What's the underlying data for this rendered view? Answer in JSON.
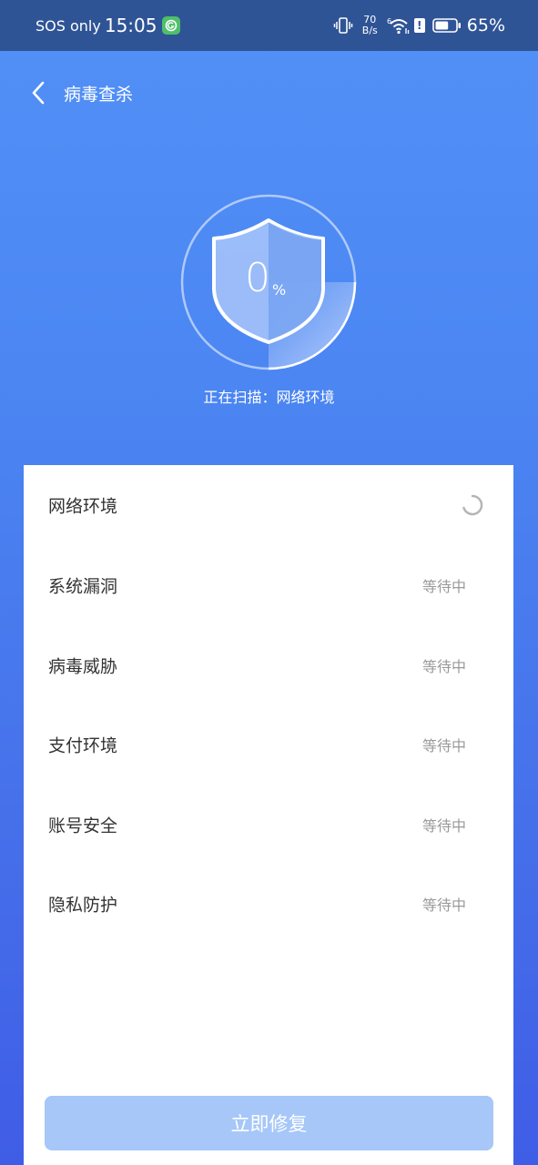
{
  "status_bar": {
    "carrier": "SOS only",
    "time": "15:05",
    "net_speed_value": "70",
    "net_speed_unit": "B/s",
    "wifi_superscript": "6",
    "battery": "65%",
    "battery_level": 0.65
  },
  "header": {
    "title": "病毒查杀"
  },
  "scan": {
    "percent": "0",
    "percent_sign": "%",
    "progress_fraction": 0.25,
    "status_text": "正在扫描：网络环境"
  },
  "checklist": [
    {
      "label": "网络环境",
      "status": "",
      "state": "scanning"
    },
    {
      "label": "系统漏洞",
      "status": "等待中",
      "state": "waiting"
    },
    {
      "label": "病毒威胁",
      "status": "等待中",
      "state": "waiting"
    },
    {
      "label": "支付环境",
      "status": "等待中",
      "state": "waiting"
    },
    {
      "label": "账号安全",
      "status": "等待中",
      "state": "waiting"
    },
    {
      "label": "隐私防护",
      "status": "等待中",
      "state": "waiting"
    }
  ],
  "repair_button": {
    "label": "立即修复"
  },
  "colors": {
    "status_bar_bg": "#2f5496",
    "header_gradient_top": "#5291f7",
    "button_disabled": "#a6c7f8",
    "waiting_text": "#9a9a9a"
  },
  "icons": {
    "back": "chevron-left-icon",
    "shield": "shield-icon",
    "spinner": "loading-spinner-icon",
    "wifi": "wifi-icon",
    "battery": "battery-icon",
    "vibrate": "vibrate-icon"
  }
}
